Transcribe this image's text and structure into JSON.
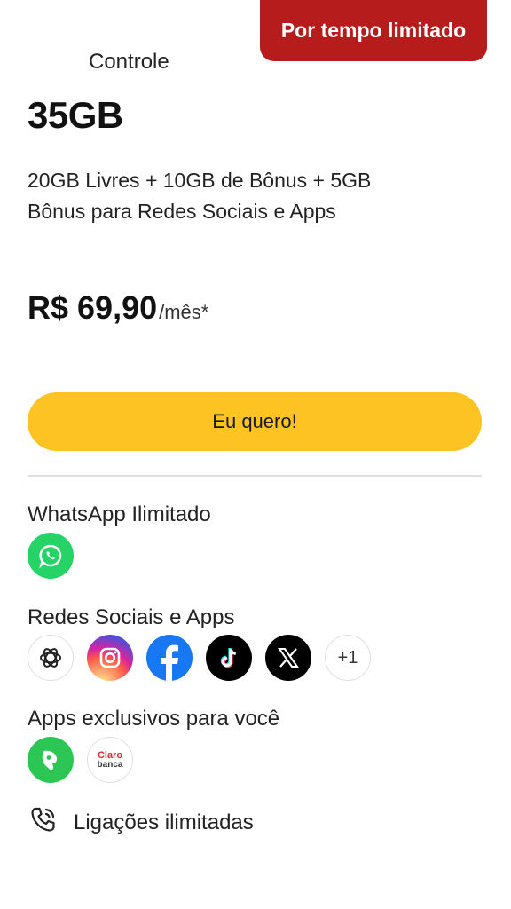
{
  "badge": {
    "label": "Por tempo limitado"
  },
  "plan": {
    "type": "Controle",
    "size": "35GB",
    "description_line1": "20GB Livres + 10GB de Bônus + 5GB",
    "description_line2": "Bônus para Redes Sociais e Apps",
    "price": "R$ 69,90",
    "price_suffix": "/mês*"
  },
  "cta": {
    "label": "Eu quero!"
  },
  "sections": {
    "whatsapp": {
      "title": "WhatsApp Ilimitado",
      "icons": [
        "whatsapp-icon"
      ]
    },
    "social": {
      "title": "Redes Sociais e Apps",
      "icons": [
        "chatgpt-icon",
        "instagram-icon",
        "facebook-icon",
        "tiktok-icon",
        "x-icon"
      ],
      "more_label": "+1"
    },
    "exclusive": {
      "title": "Apps exclusivos para você",
      "icons": [
        "green-app-icon",
        "claro-banca-icon"
      ],
      "claro_banca_text_1": "Claro",
      "claro_banca_text_2": "banca"
    }
  },
  "calls": {
    "label": "Ligações ilimitadas",
    "icon": "phone-icon"
  },
  "colors": {
    "badge": "#b71c1c",
    "cta": "#fdc322",
    "whatsapp": "#25d366",
    "facebook": "#1877f2"
  }
}
